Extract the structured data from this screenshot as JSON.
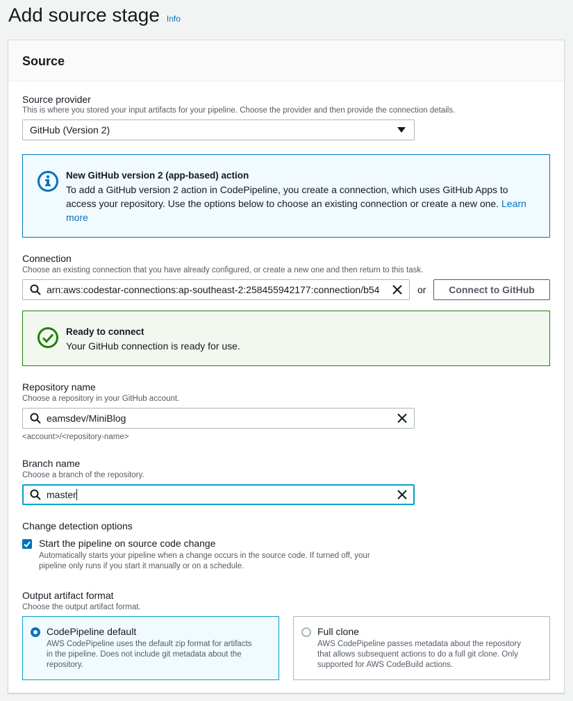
{
  "page": {
    "title": "Add source stage",
    "info_link": "Info"
  },
  "panel": {
    "title": "Source"
  },
  "source_provider": {
    "label": "Source provider",
    "description": "This is where you stored your input artifacts for your pipeline. Choose the provider and then provide the connection details.",
    "selected": "GitHub (Version 2)"
  },
  "info_alert": {
    "title": "New GitHub version 2 (app-based) action",
    "body_line1": "To add a GitHub version 2 action in CodePipeline, you create a connection, which uses GitHub Apps to",
    "body_line2": "access your repository. Use the options below to choose an existing connection or create a new one.",
    "link_part1": "Learn",
    "link_part2": "more"
  },
  "connection": {
    "label": "Connection",
    "description": "Choose an existing connection that you have already configured, or create a new one and then return to this task.",
    "value": "arn:aws:codestar-connections:ap-southeast-2:258455942177:connection/b54",
    "or_text": "or",
    "connect_button": "Connect to GitHub"
  },
  "success_alert": {
    "title": "Ready to connect",
    "body": "Your GitHub connection is ready for use."
  },
  "repository": {
    "label": "Repository name",
    "description": "Choose a repository in your GitHub account.",
    "value": "eamsdev/MiniBlog",
    "hint": "<account>/<repository-name>"
  },
  "branch": {
    "label": "Branch name",
    "description": "Choose a branch of the repository.",
    "value": "master"
  },
  "change_detection": {
    "label": "Change detection options",
    "checkbox_label": "Start the pipeline on source code change",
    "checkbox_desc_line1": "Automatically starts your pipeline when a change occurs in the source code. If turned off, your",
    "checkbox_desc_line2": "pipeline only runs if you start it manually or on a schedule.",
    "checked": true
  },
  "output_format": {
    "label": "Output artifact format",
    "description": "Choose the output artifact format.",
    "options": [
      {
        "title": "CodePipeline default",
        "desc_line1": "AWS CodePipeline uses the default zip format for artifacts",
        "desc_line2": "in the pipeline. Does not include git metadata about the",
        "desc_line3": "repository.",
        "selected": true
      },
      {
        "title": "Full clone",
        "desc_line1": "AWS CodePipeline passes metadata about the repository",
        "desc_line2": "that allows subsequent actions to do a full git clone. Only",
        "desc_line3": "supported for AWS CodeBuild actions.",
        "selected": false
      }
    ]
  },
  "colors": {
    "link": "#0073bb",
    "info_border": "#0073bb",
    "success_border": "#1d8102",
    "focus": "#00a1c9"
  }
}
